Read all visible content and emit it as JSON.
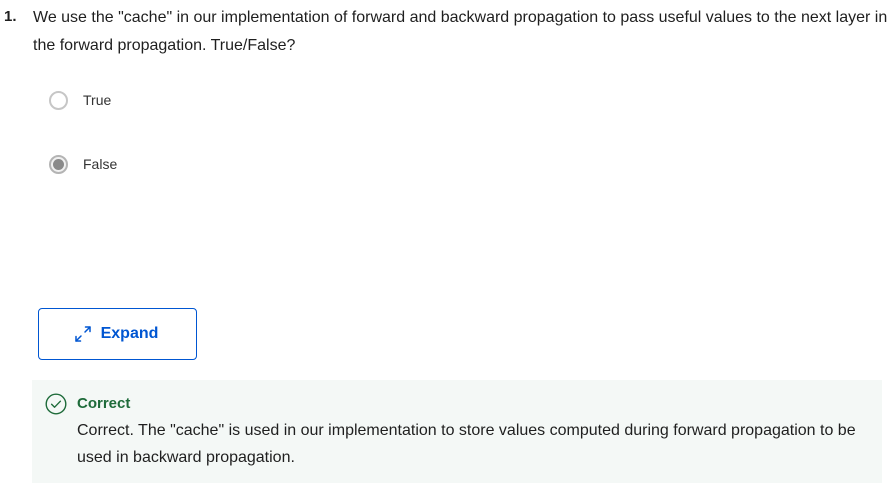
{
  "question": {
    "number": "1.",
    "text": "We use the \"cache\" in our implementation of forward and backward propagation to pass useful values to the next layer in the forward propagation. True/False?"
  },
  "options": [
    {
      "label": "True",
      "selected": false
    },
    {
      "label": "False",
      "selected": true
    }
  ],
  "expand": {
    "label": "Expand",
    "icon": "expand-arrows-icon"
  },
  "feedback": {
    "status": "Correct",
    "icon": "check-circle-icon",
    "text": "Correct. The \"cache\" is used in our implementation to store values computed during forward propagation to be used in backward propagation."
  },
  "colors": {
    "accent": "#0056d2",
    "success": "#1e6b3a",
    "feedback_bg": "#f4f8f6"
  }
}
